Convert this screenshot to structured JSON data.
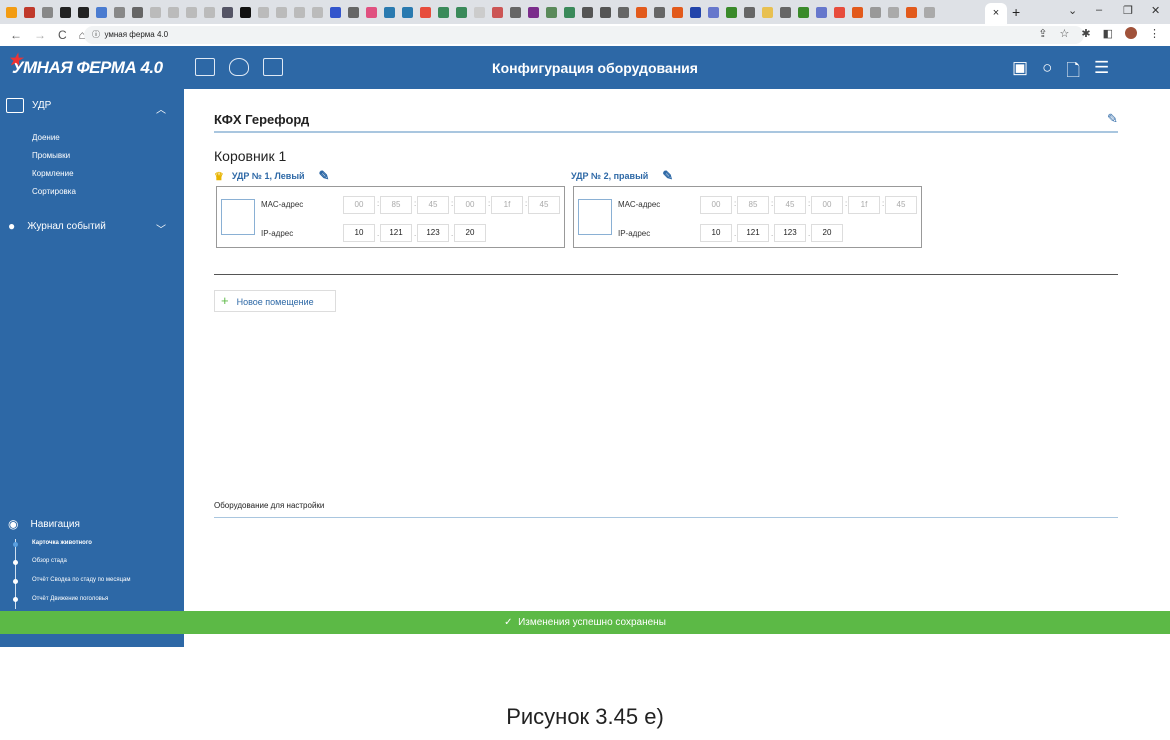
{
  "browser": {
    "address": "умная ферма 4.0",
    "close_tab": "×",
    "new_tab": "+"
  },
  "header": {
    "logo": "УМНАЯ ФЕРМА 4.0",
    "title": "Конфигурация оборудования"
  },
  "sidebar": {
    "udr": {
      "label": "УДР",
      "items": [
        "Доение",
        "Промывки",
        "Кормление",
        "Сортировка"
      ]
    },
    "journal": {
      "label": "Журнал событий"
    },
    "navigation": {
      "label": "Навигация",
      "items": [
        "Карточка животного",
        "Обзор стада",
        "Отчёт Сводка по стаду по месяцам",
        "Отчёт Движение поголовья"
      ]
    }
  },
  "main": {
    "farm": "КФХ Герефорд",
    "barn": "Коровник 1",
    "devices": [
      {
        "name": "УДР № 1, Левый",
        "main": true,
        "mac_label": "МАС-адрес",
        "ip_label": "IP-адрес",
        "mac": [
          "00",
          "85",
          "45",
          "00",
          "1f",
          "45"
        ],
        "ip": [
          "10",
          "121",
          "123",
          "20"
        ]
      },
      {
        "name": "УДР № 2, правый",
        "main": false,
        "mac_label": "МАС-адрес",
        "ip_label": "IP-адрес",
        "mac": [
          "00",
          "85",
          "45",
          "00",
          "1f",
          "45"
        ],
        "ip": [
          "10",
          "121",
          "123",
          "20"
        ]
      }
    ],
    "new_room": "Новое помещение",
    "equipment_title": "Оборудование для настройки"
  },
  "toast": "Изменения успешно сохранены",
  "caption": "Рисунок 3.45 е)",
  "colors": {
    "primary": "#2d68a6",
    "success": "#5cb946",
    "crown": "#e8b400"
  }
}
